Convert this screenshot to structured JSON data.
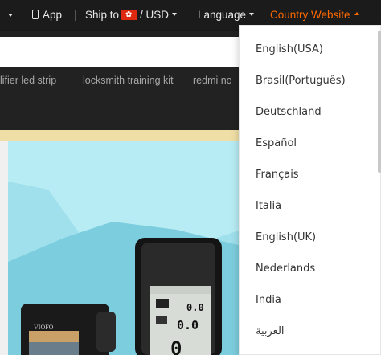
{
  "topbar": {
    "app_label": "App",
    "ship_to_label": "Ship to",
    "currency": "/ USD",
    "language_label": "Language",
    "country_website_label": "Country Website"
  },
  "keywords": [
    "lifier led strip",
    "locksmith training kit",
    "redmi no"
  ],
  "country_menu": {
    "items": [
      "English(USA)",
      "Brasil(Português)",
      "Deutschland",
      "Español",
      "Français",
      "Italia",
      "English(UK)",
      "Nederlands",
      "India",
      "العربية"
    ]
  },
  "colors": {
    "topbar_bg": "#1b1b1b",
    "accent": "#ff6a00",
    "banner_bg": "#9fe0ec"
  },
  "banner": {
    "brand_text": "VIOFO",
    "device_readout_1": "0.0",
    "device_readout_2": "0.0",
    "device_readout_3": "0"
  }
}
